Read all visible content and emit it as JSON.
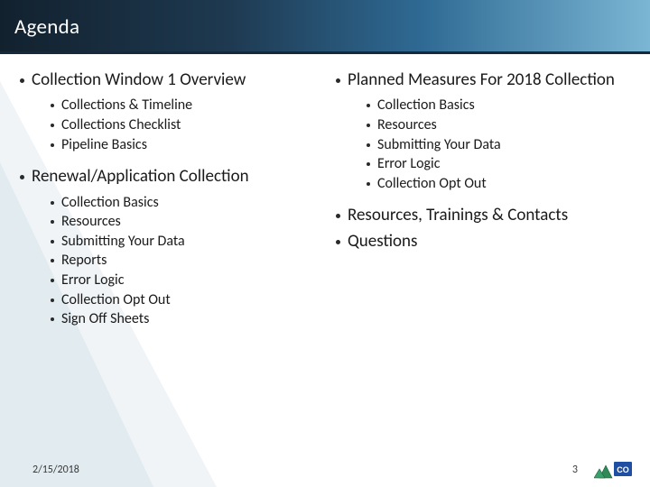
{
  "header": {
    "title": "Agenda"
  },
  "colors": {
    "headerGradientStart": "#12212e",
    "headerGradientEnd": "#7bb6d4",
    "text": "#1a1a1a"
  },
  "left": [
    {
      "title": "Collection Window 1 Overview",
      "items": [
        "Collections & Timeline",
        "Collections Checklist",
        "Pipeline Basics"
      ]
    },
    {
      "title": "Renewal/Application Collection",
      "items": [
        "Collection Basics",
        "Resources",
        "Submitting Your Data",
        "Reports",
        "Error Logic",
        "Collection Opt Out",
        "Sign Off Sheets"
      ]
    }
  ],
  "right": [
    {
      "title": "Planned Measures For 2018 Collection",
      "items": [
        "Collection Basics",
        "Resources",
        "Submitting Your Data",
        "Error Logic",
        "Collection Opt Out"
      ]
    },
    {
      "title": "Resources, Trainings & Contacts",
      "items": []
    },
    {
      "title": "Questions",
      "items": []
    }
  ],
  "footer": {
    "date": "2/15/2018",
    "page": "3",
    "logoName": "co-state-logo"
  }
}
